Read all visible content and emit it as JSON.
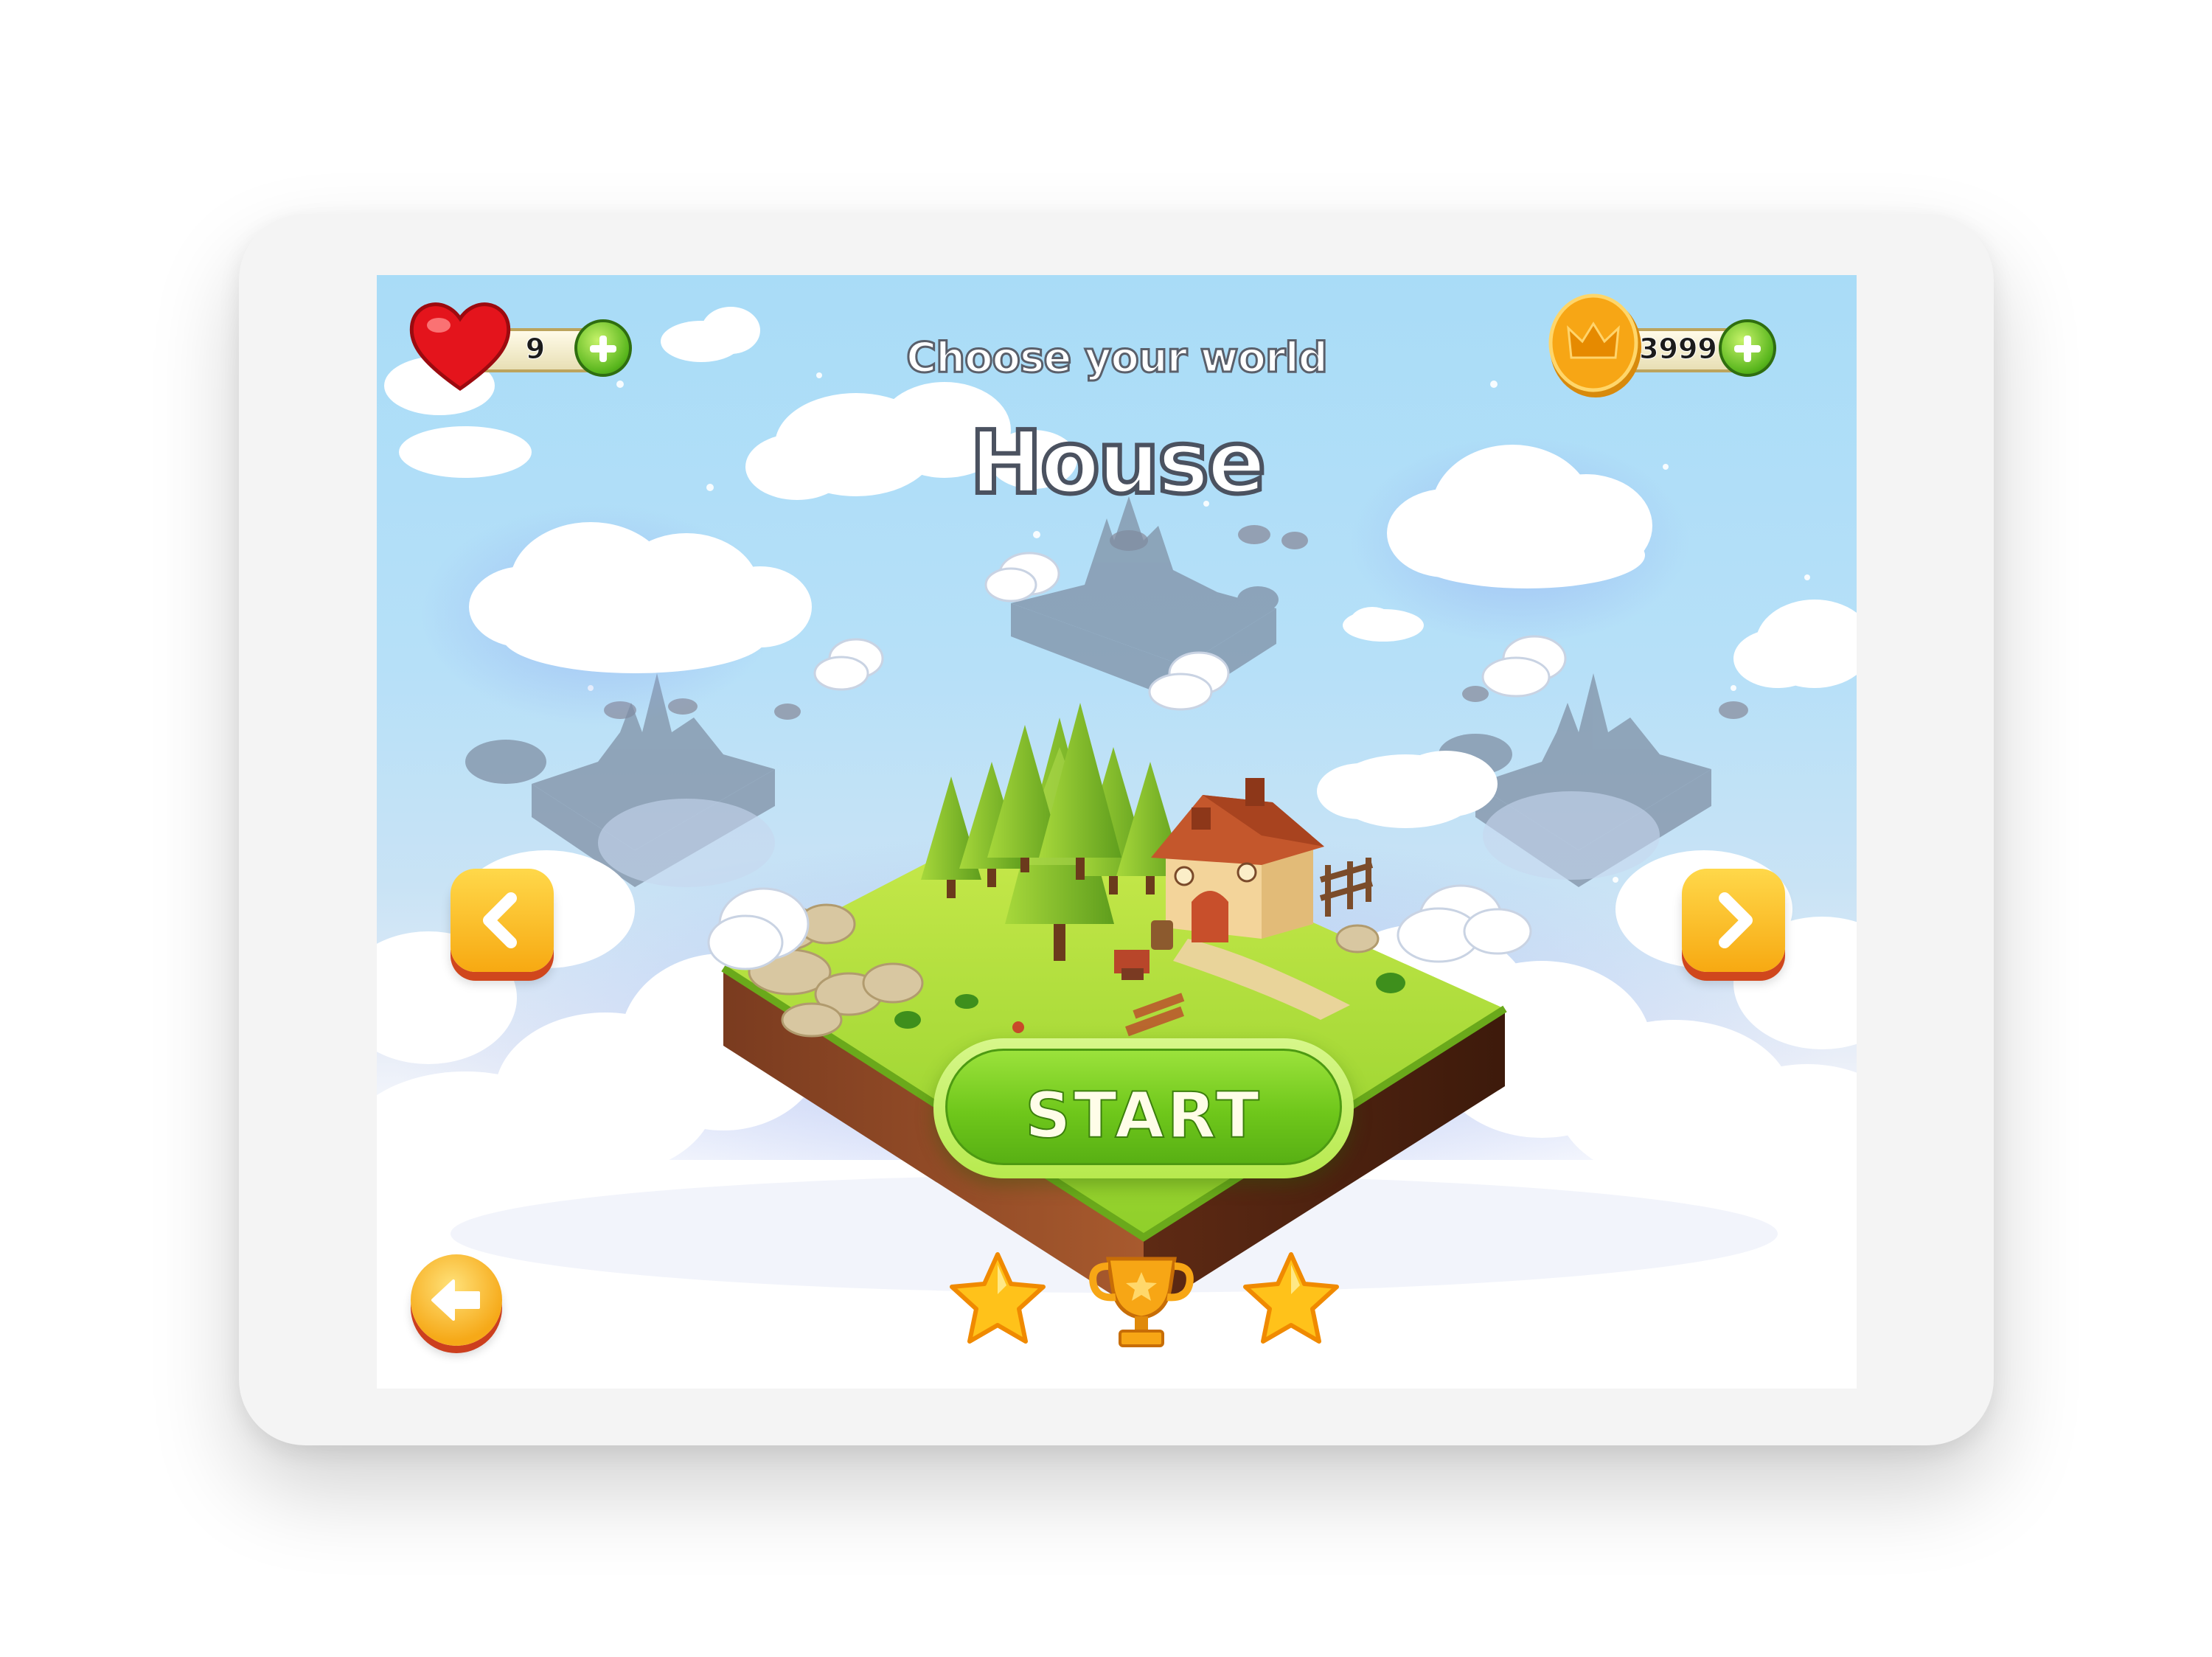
{
  "hud": {
    "lives": "9",
    "coins": "3999"
  },
  "header": {
    "subtitle": "Choose your world",
    "world_name": "House"
  },
  "actions": {
    "start_label": "START"
  },
  "rating": {
    "stars_earned": 2,
    "has_trophy": true
  },
  "icons": {
    "lives": "heart-icon",
    "coins": "crown-coin-icon",
    "add": "plus-icon",
    "prev": "chevron-left-icon",
    "next": "chevron-right-icon",
    "back": "arrow-left-icon",
    "rating_left": "star-icon",
    "rating_center": "trophy-icon",
    "rating_right": "star-icon"
  },
  "colors": {
    "sky": "#a9dcf7",
    "start_green": "#6fc71b",
    "nav_yellow": "#ffc727",
    "nav_shadow": "#d0471d",
    "heart_red": "#e4141c",
    "coin_gold": "#f7a615"
  }
}
